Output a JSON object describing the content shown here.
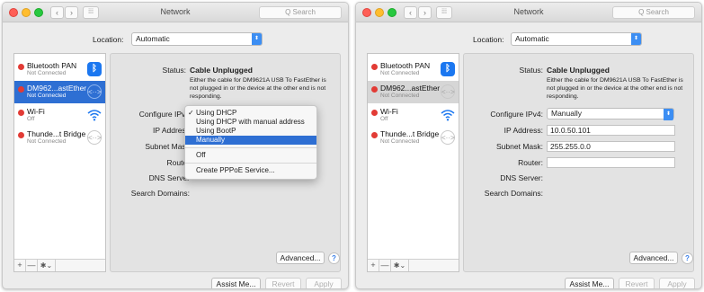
{
  "window_title": "Network",
  "search_placeholder": "Q Search",
  "location": {
    "label": "Location:",
    "value": "Automatic"
  },
  "services": [
    {
      "name": "Bluetooth PAN",
      "status": "Not Connected"
    },
    {
      "name": "DM962...astEther",
      "status": "Not Connected"
    },
    {
      "name": "Wi-Fi",
      "status": "Off"
    },
    {
      "name": "Thunde...t Bridge",
      "status": "Not Connected"
    }
  ],
  "sidebar_tools": {
    "plus": "+",
    "minus": "—",
    "gear": "✱⌄"
  },
  "status": {
    "label": "Status:",
    "value": "Cable Unplugged",
    "description": "Either the cable for DM9621A USB To FastEther is not plugged in or the device at the other end is not responding."
  },
  "labels": {
    "configure": "Configure IPv4:",
    "ip": "IP Address:",
    "subnet": "Subnet Mask:",
    "router": "Router:",
    "dns": "DNS Server:",
    "search_domains": "Search Domains:"
  },
  "labels_truncated": {
    "configure": "Configure IPv4",
    "ip": "IP Address",
    "subnet": "Subnet Mask",
    "router": "Router",
    "dns": "DNS Server",
    "search_domains": "Search Domains:"
  },
  "config_menu": {
    "checkmark": "✓",
    "items": [
      "Using DHCP",
      "Using DHCP with manual address",
      "Using BootP",
      "Manually",
      "Off",
      "Create PPPoE Service..."
    ]
  },
  "manual_config": {
    "configure_value": "Manually",
    "ip_address": "10.0.50.101",
    "subnet_mask": "255.255.0.0",
    "router": ""
  },
  "buttons": {
    "advanced": "Advanced...",
    "help": "?",
    "assist": "Assist Me...",
    "revert": "Revert",
    "apply": "Apply"
  },
  "colors": {
    "selection_blue": "#2e6fd3",
    "status_red": "#e23b35",
    "popup_arrow_blue": "#3c8ef3"
  }
}
